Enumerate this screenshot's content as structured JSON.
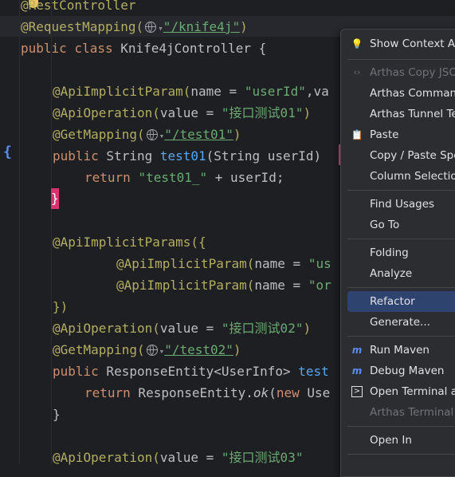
{
  "code": {
    "line1": "@RestController",
    "req_map": "@RequestMapping(",
    "req_url": "\"/knife4j\"",
    "req_close": ")",
    "class_kw": "public class",
    "class_name": " Knife4jController {",
    "imp_param": "@ApiImplicitParam(",
    "imp_param_args": "name = ",
    "imp_param_val": "\"userId\"",
    "imp_param_tail": ",va",
    "api_op1": "@ApiOperation(",
    "api_op1_args": "value = ",
    "api_op1_val": "\"接口测试01\"",
    "paren_close": ")",
    "get_map": "@GetMapping(",
    "test01_url": "\"/test01\"",
    "pub": "public",
    "string_type": " String ",
    "test01_fn": "test01",
    "test01_args": "(String userId) ",
    "ret": "return",
    "ret_str": " \"test01_\"",
    "ret_tail": " + userId;",
    "close_brace": "}",
    "imp_params": "@ApiImplicitParams({",
    "imp_p1": "@ApiImplicitParam(",
    "imp_p1_args": "name = ",
    "imp_p1_val": "\"us",
    "imp_p2": "@ApiImplicitParam(",
    "imp_p2_args": "name = ",
    "imp_p2_val": "\"or",
    "imp_params_close": "})",
    "api_op2": "@ApiOperation(",
    "api_op2_args": "value = ",
    "api_op2_val": "\"接口测试02\"",
    "test02_url": "\"/test02\"",
    "resp_type": " ResponseEntity<UserInfo> ",
    "test02_fn": "test",
    "ret2_a": " ResponseEntity.",
    "ret2_ok": "ok",
    "ret2_b": "(",
    "ret2_new": "new",
    "ret2_c": " Use",
    "api_op3": "@ApiOperation(",
    "api_op3_args": "value = ",
    "api_op3_val": "\"接口测试03\""
  },
  "menu": {
    "show_context": "Show Context Ac",
    "arthas_copy": "Arthas Copy JSON",
    "arthas_command": "Arthas Command",
    "arthas_tunnel": "Arthas Tunnel Ter",
    "paste": "Paste",
    "copy_paste_special": "Copy / Paste Spec",
    "column_selection": "Column Selection",
    "find_usages": "Find Usages",
    "go_to": "Go To",
    "folding": "Folding",
    "analyze": "Analyze",
    "refactor": "Refactor",
    "generate": "Generate...",
    "run_maven": "Run Maven",
    "debug_maven": "Debug Maven",
    "open_terminal": "Open Terminal at",
    "arthas_terminal": "Arthas Terminal 'n",
    "open_in": "Open In"
  },
  "icons": {
    "show_context": "lightbulb-icon",
    "arthas_copy": "brackets-icon",
    "paste": "clipboard-icon",
    "run_maven": "maven-icon",
    "debug_maven": "maven-icon",
    "open_terminal": "terminal-icon"
  },
  "colors": {
    "editor_bg": "#1e1f22",
    "menu_bg": "#2b2d30",
    "menu_selected": "#2e436e",
    "annotation": "#b3ae60",
    "keyword": "#cf8e6d",
    "string": "#6aab73",
    "function": "#56a8f5"
  }
}
